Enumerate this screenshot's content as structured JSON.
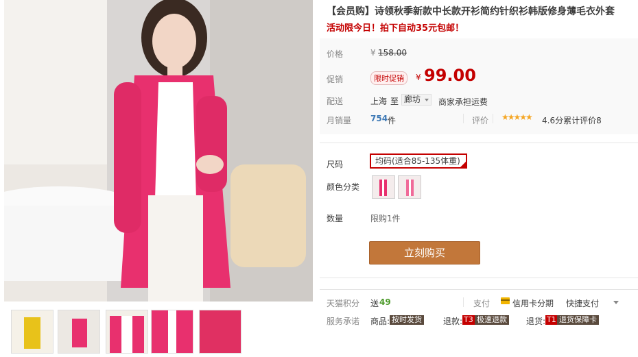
{
  "product": {
    "title": "【会员购】诗领秋季新款中长款开衫简约针织衫韩版修身薄毛衣外套",
    "promo_line": "活动限今日！拍下自动35元包邮！"
  },
  "price": {
    "original_label": "价格",
    "original_currency": "¥",
    "original_value": "158.00",
    "promo_label": "促销",
    "promo_badge": "限时促销",
    "promo_currency": "¥",
    "promo_value": "99.00"
  },
  "shipping": {
    "label": "配送",
    "from": "上海",
    "to_word": "至",
    "destination": "廊坊",
    "note": "商家承担运费"
  },
  "sales": {
    "label": "月销量",
    "count": "754",
    "unit": "件",
    "review_label": "评价",
    "stars": "★★★★★",
    "rating_text": "4.6分累计评价8"
  },
  "options": {
    "size_label": "尺码",
    "size_value": "均码(适合85-135体重)",
    "color_label": "颜色分类",
    "qty_label": "数量",
    "qty_limit": "限购1件"
  },
  "buy_button": "立刻购买",
  "bottom": {
    "points_label": "天猫积分",
    "points_prefix": "送",
    "points_value": "49",
    "pay_label": "支付",
    "card_installment": "信用卡分期",
    "quick_pay": "快捷支付",
    "service_label": "服务承诺",
    "goods_label": "商品:",
    "goods_tag": "按时发货",
    "refund_label": "退款:",
    "refund_code": "T3",
    "refund_tag": "极速退款",
    "return_label": "退货:",
    "return_code": "T1",
    "return_tag": "退货保障卡"
  },
  "colors": {
    "accent": "#c40000",
    "buy_button": "#c2773a",
    "sweater": "#e8306e",
    "star": "#f5a623"
  }
}
